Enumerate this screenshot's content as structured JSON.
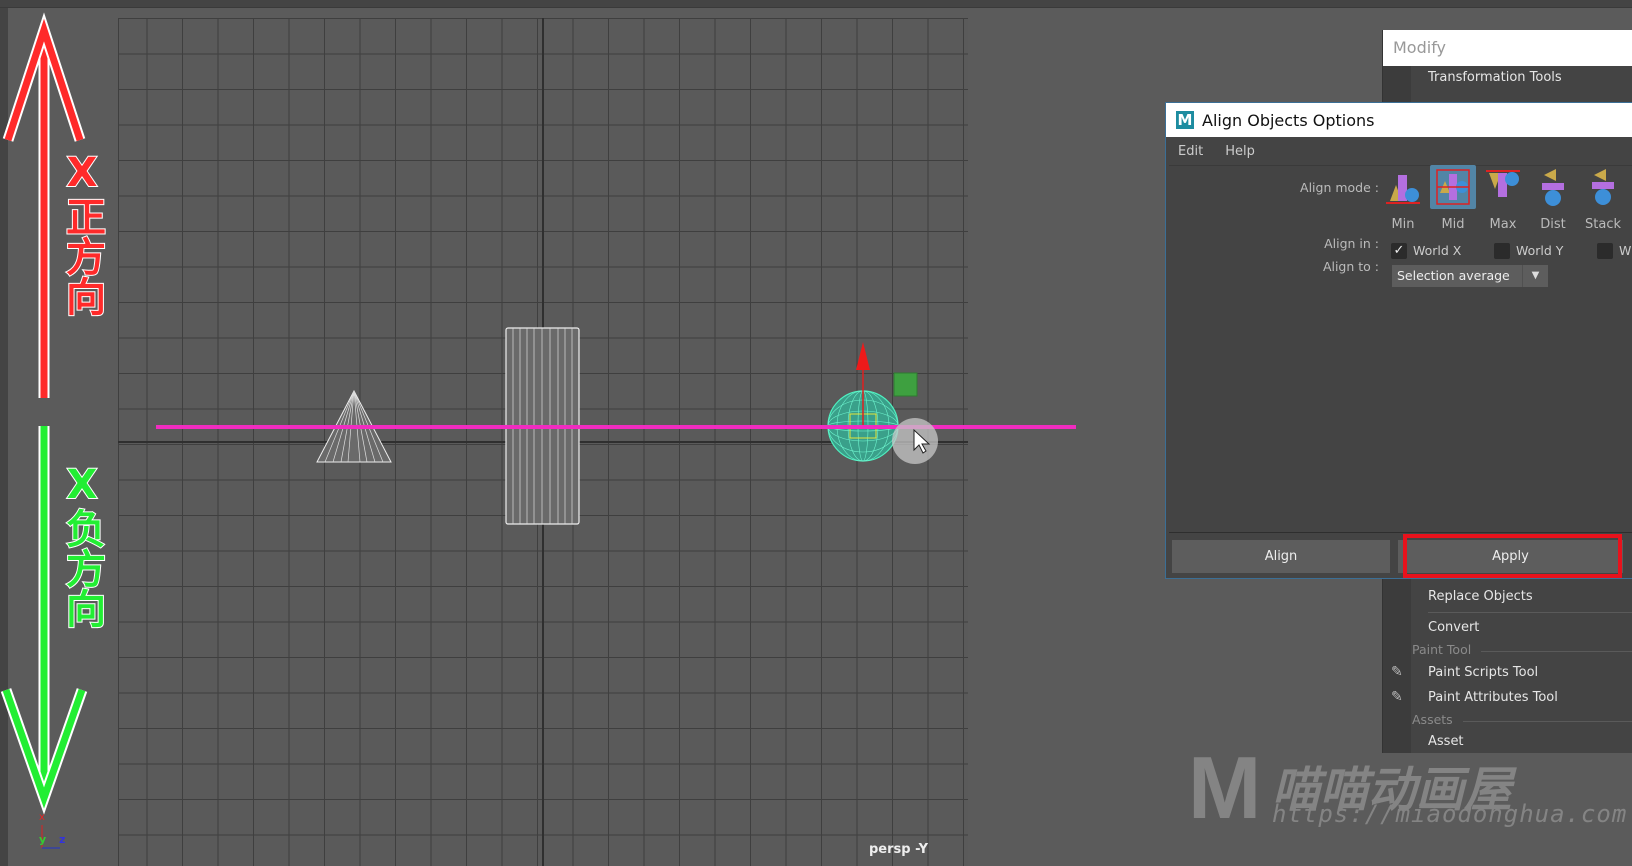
{
  "viewport": {
    "camera_label": "persp -Y",
    "axis_gizmo": {
      "x": "x",
      "y": "y",
      "z": "z"
    }
  },
  "annotations": {
    "positive": "X正方向",
    "negative": "X负方向",
    "positive_color": "#ff2a2a",
    "negative_color": "#22ee33"
  },
  "modify_menu": {
    "title": "Modify",
    "items": [
      {
        "type": "item",
        "label": "Transformation Tools"
      },
      {
        "type": "item",
        "label": "Replace Objects"
      },
      {
        "type": "item",
        "label": "Convert"
      },
      {
        "type": "section",
        "label": "Paint Tool"
      },
      {
        "type": "item",
        "label": "Paint Scripts Tool"
      },
      {
        "type": "item",
        "label": "Paint Attributes Tool"
      },
      {
        "type": "section",
        "label": "Assets"
      },
      {
        "type": "item",
        "label": "Asset"
      }
    ]
  },
  "dialog": {
    "title": "Align Objects Options",
    "menu": [
      "Edit",
      "Help"
    ],
    "align_mode_label": "Align mode :",
    "modes": [
      {
        "label": "Min"
      },
      {
        "label": "Mid",
        "selected": true
      },
      {
        "label": "Max"
      },
      {
        "label": "Dist"
      },
      {
        "label": "Stack"
      }
    ],
    "align_in_label": "Align in :",
    "align_in": [
      {
        "label": "World X",
        "checked": true
      },
      {
        "label": "World Y",
        "checked": false
      },
      {
        "label": "W",
        "checked": false
      }
    ],
    "align_to_label": "Align to :",
    "align_to_value": "Selection average",
    "buttons": {
      "align": "Align",
      "apply": "Apply"
    },
    "highlight_color": "#e8121c"
  },
  "watermark": {
    "logo": "M",
    "name": "喵喵动画屋",
    "url": "https://miaodonghua.com"
  }
}
